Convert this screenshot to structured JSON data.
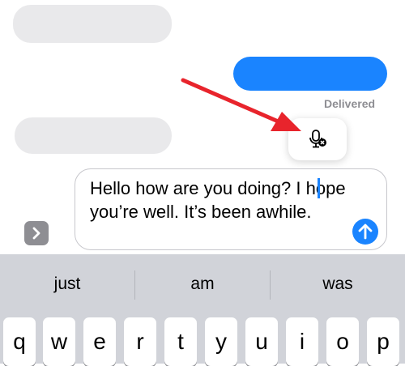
{
  "conversation": {
    "delivered_status": "Delivered"
  },
  "icons": {
    "mic_popup": "microphone-off-icon",
    "expand": "chevron-right-icon",
    "send": "arrow-up-icon"
  },
  "composer": {
    "text": "Hello how are you doing? I hope you’re well. It’s been awhile."
  },
  "keyboard": {
    "suggestions": [
      "just",
      "am",
      "was"
    ],
    "row1": [
      "q",
      "w",
      "e",
      "r",
      "t",
      "y",
      "u",
      "i",
      "o",
      "p"
    ]
  },
  "colors": {
    "accent": "#1a84ff",
    "annotation_arrow": "#e8242c",
    "bubble_gray": "#e9e9eb",
    "keyboard_bg": "#d1d3d9"
  }
}
